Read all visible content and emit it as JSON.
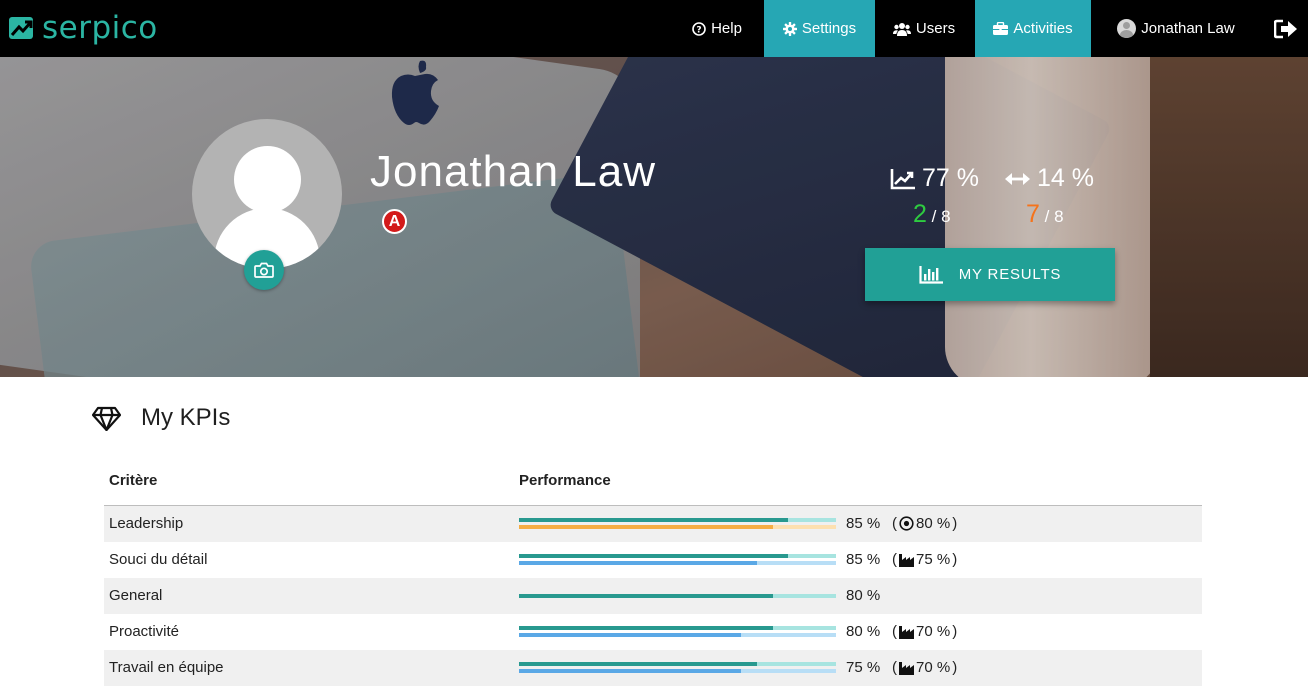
{
  "brand": {
    "name": "serpico"
  },
  "navbar": {
    "help": "Help",
    "settings": "Settings",
    "users": "Users",
    "activities": "Activities",
    "user_name": "Jonathan Law",
    "active_color": "#26a7b4"
  },
  "profile": {
    "name": "Jonathan Law",
    "role_badge": "A",
    "progression": "77 %",
    "variation": "14 %",
    "score_a_value": "2",
    "score_a_total": "/ 8",
    "score_b_value": "7",
    "score_b_total": "/ 8",
    "results_button": "MY RESULTS"
  },
  "kpis": {
    "title": "My KPIs",
    "col_criteria": "Critère",
    "col_performance": "Performance",
    "rows": [
      {
        "name": "Leadership",
        "performance": 85,
        "pct_label": "85 %",
        "reference": "80 %",
        "reference_value": 80,
        "reference_icon": "target-icon",
        "reference_color": "orange"
      },
      {
        "name": "Souci du détail",
        "performance": 85,
        "pct_label": "85 %",
        "reference": "75 %",
        "reference_value": 75,
        "reference_icon": "industry-icon",
        "reference_color": "blue"
      },
      {
        "name": "General",
        "performance": 80,
        "pct_label": "80 %"
      },
      {
        "name": "Proactivité",
        "performance": 80,
        "pct_label": "80 %",
        "reference": "70 %",
        "reference_value": 70,
        "reference_icon": "industry-icon",
        "reference_color": "blue"
      },
      {
        "name": "Travail en équipe",
        "performance": 75,
        "pct_label": "75 %",
        "reference": "70 %",
        "reference_value": 70,
        "reference_icon": "industry-icon",
        "reference_color": "blue"
      }
    ]
  }
}
